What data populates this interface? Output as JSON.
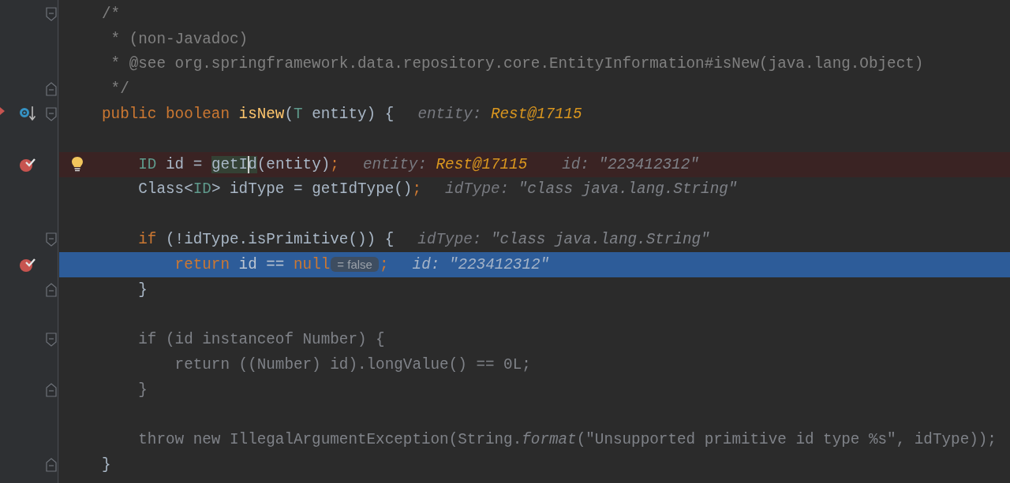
{
  "editor": {
    "lines": [
      {
        "kind": "code",
        "fold_start": true,
        "segments": [
          {
            "kind": "code",
            "tokens": [
              {
                "kind": "comment",
                "t": "/*"
              }
            ]
          }
        ]
      },
      {
        "kind": "code",
        "segments": [
          {
            "kind": "code",
            "tokens": [
              {
                "kind": "comment",
                "t": " * (non-Javadoc)"
              }
            ]
          }
        ]
      },
      {
        "kind": "code",
        "segments": [
          {
            "kind": "code",
            "tokens": [
              {
                "kind": "comment",
                "t": " * @see org.springframework.data.repository.core.EntityInformation#isNew(java.lang.Object)"
              }
            ]
          }
        ]
      },
      {
        "kind": "code",
        "fold_end": true,
        "segments": [
          {
            "kind": "code",
            "tokens": [
              {
                "kind": "comment",
                "t": " */"
              }
            ]
          }
        ]
      },
      {
        "kind": "code",
        "execution_point": true,
        "fold_start": true,
        "segments": [
          {
            "kind": "code",
            "tokens": [
              {
                "kind": "keyword",
                "t": "public boolean "
              },
              {
                "kind": "declaration",
                "t": "isNew"
              },
              {
                "kind": "plain",
                "t": "("
              },
              {
                "kind": "type",
                "t": "T"
              },
              {
                "kind": "plain",
                "t": " entity) {"
              }
            ]
          },
          {
            "kind": "hint",
            "name": "entity:",
            "value": "Rest@17115",
            "object": true
          }
        ]
      },
      {
        "kind": "blank"
      },
      {
        "kind": "code",
        "breakpoint": true,
        "bulb": true,
        "segments": [
          {
            "kind": "code",
            "tokens": [
              {
                "kind": "type",
                "t": "    ID"
              },
              {
                "kind": "plain",
                "t": " id = "
              },
              {
                "kind": "usage",
                "t": "getId"
              },
              {
                "kind": "plain",
                "t": "(entity)"
              },
              {
                "kind": "keyword",
                "t": ";"
              }
            ]
          },
          {
            "kind": "hint",
            "name": "entity:",
            "value": "Rest@17115",
            "object": true
          },
          {
            "kind": "hint",
            "name": "id:",
            "value": "\"223412312\"",
            "object": false
          }
        ]
      },
      {
        "kind": "code",
        "segments": [
          {
            "kind": "code",
            "tokens": [
              {
                "kind": "plain",
                "t": "    Class<"
              },
              {
                "kind": "type",
                "t": "ID"
              },
              {
                "kind": "plain",
                "t": "> idType = getIdType()"
              },
              {
                "kind": "keyword",
                "t": ";"
              }
            ]
          },
          {
            "kind": "hint",
            "name": "idType:",
            "value": "\"class java.lang.String\"",
            "object": false
          }
        ]
      },
      {
        "kind": "blank"
      },
      {
        "kind": "code",
        "fold_start": true,
        "segments": [
          {
            "kind": "code",
            "tokens": [
              {
                "kind": "keyword",
                "t": "    if"
              },
              {
                "kind": "plain",
                "t": " (!idType.isPrimitive()) {"
              }
            ]
          },
          {
            "kind": "hint",
            "name": "idType:",
            "value": "\"class java.lang.String\"",
            "object": false
          }
        ]
      },
      {
        "kind": "code",
        "breakpoint": true,
        "current": true,
        "segments": [
          {
            "kind": "code",
            "tokens": [
              {
                "kind": "keyword",
                "t": "        return"
              },
              {
                "kind": "plain",
                "t": " id == "
              },
              {
                "kind": "keyword",
                "t": "null"
              }
            ]
          },
          {
            "kind": "value",
            "text": "= false"
          },
          {
            "kind": "code",
            "tokens": [
              {
                "kind": "keyword",
                "t": ";"
              }
            ]
          },
          {
            "kind": "hint",
            "name": "id:",
            "value": "\"223412312\"",
            "object": false
          }
        ]
      },
      {
        "kind": "code",
        "fold_end": true,
        "segments": [
          {
            "kind": "code",
            "tokens": [
              {
                "kind": "plain",
                "t": "    }"
              }
            ]
          }
        ]
      },
      {
        "kind": "blank"
      },
      {
        "kind": "code",
        "fold_start": true,
        "segments": [
          {
            "kind": "code",
            "tokens": [
              {
                "kind": "dim",
                "t": "    if (id instanceof Number) {"
              }
            ]
          }
        ]
      },
      {
        "kind": "code",
        "segments": [
          {
            "kind": "code",
            "tokens": [
              {
                "kind": "dim",
                "t": "        return ((Number) id).longValue() == 0L;"
              }
            ]
          }
        ]
      },
      {
        "kind": "code",
        "fold_end": true,
        "segments": [
          {
            "kind": "code",
            "tokens": [
              {
                "kind": "dim",
                "t": "    }"
              }
            ]
          }
        ]
      },
      {
        "kind": "blank"
      },
      {
        "kind": "code",
        "segments": [
          {
            "kind": "code",
            "tokens": [
              {
                "kind": "dim",
                "t": "    throw new IllegalArgumentException(String."
              },
              {
                "kind": "dim_italic",
                "t": "format"
              },
              {
                "kind": "dim",
                "t": "(\"Unsupported primitive id type %s\", idType));"
              }
            ]
          }
        ]
      },
      {
        "kind": "code",
        "fold_end": true,
        "segments": [
          {
            "kind": "code",
            "tokens": [
              {
                "kind": "plain",
                "t": "}"
              }
            ]
          }
        ]
      }
    ]
  }
}
